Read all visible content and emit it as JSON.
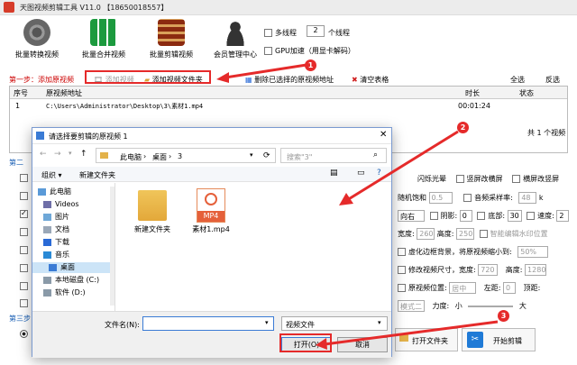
{
  "app": {
    "title": "天图视频剪辑工具 V11.0 【18650018557】"
  },
  "toolbar": {
    "buttons": [
      {
        "label": "批量转换视频",
        "icon": "film-reel-icon"
      },
      {
        "label": "批量合并视频",
        "icon": "merge-grid-icon"
      },
      {
        "label": "批量剪辑视频",
        "icon": "film-strip-icon"
      },
      {
        "label": "会员管理中心",
        "icon": "user-icon"
      }
    ],
    "multithread_label": "多线程",
    "thread_count": "2",
    "thread_unit": "个线程",
    "gpu_label": "GPU加速（用显卡解码）"
  },
  "step1": {
    "label": "第一步：添加原视频",
    "add_video": "添加视频",
    "add_folder": "添加视频文件夹",
    "delete_selected": "删除已选择的原视频地址",
    "clear_table": "清空表格",
    "select_all": "全选",
    "invert": "反选"
  },
  "table": {
    "headers": [
      "序号",
      "原视频地址",
      "时长",
      "状态"
    ],
    "rows": [
      {
        "index": "1",
        "path": "C:\\Users\\Administrator\\Desktop\\3\\素材1.mp4",
        "duration": "00:01:24",
        "status": ""
      }
    ],
    "total": "共 1 个视频"
  },
  "step2": {
    "label_fragment": "第二"
  },
  "step3": {
    "label_fragment": "第三步"
  },
  "right_panel": {
    "r1": [
      "闪烁光晕",
      "竖屏改横屏",
      "横屏改竖屏"
    ],
    "r2_labels": [
      "随机饱和",
      "0.5",
      "音频采样率:",
      "48",
      "k"
    ],
    "r3": [
      "向右",
      "阴影:",
      "0",
      "底部:",
      "30",
      "速度:",
      "2"
    ],
    "r4": [
      "宽度:",
      "260",
      "高度:",
      "250",
      "智能编辑水印位置"
    ],
    "r5": [
      "虚化边框背景，将原视频缩小到:",
      "50%"
    ],
    "r6": [
      "修改视频尺寸，宽度:",
      "720",
      "高度:",
      "1280"
    ],
    "r7": [
      "原视频位置:",
      "居中",
      "左距:",
      "0",
      "顶距:"
    ],
    "r8": [
      "模式二",
      "力度:",
      "小",
      "大"
    ]
  },
  "bottom": {
    "open_folder": "打开文件夹",
    "start": "开始剪辑"
  },
  "dialog": {
    "title": "请选择要剪辑的原视频 1",
    "breadcrumb": [
      "此电脑",
      "桌面",
      "3"
    ],
    "search_placeholder": "搜索\"3\"",
    "organize": "组织 ▾",
    "new_folder": "新建文件夹",
    "tree": [
      {
        "label": "此电脑",
        "icon": "computer-icon"
      },
      {
        "label": "Videos",
        "icon": "video-folder-icon"
      },
      {
        "label": "图片",
        "icon": "pictures-icon"
      },
      {
        "label": "文档",
        "icon": "documents-icon"
      },
      {
        "label": "下载",
        "icon": "download-icon"
      },
      {
        "label": "音乐",
        "icon": "music-icon"
      },
      {
        "label": "桌面",
        "icon": "desktop-icon"
      },
      {
        "label": "本地磁盘 (C:)",
        "icon": "drive-icon"
      },
      {
        "label": "软件 (D:)",
        "icon": "drive-icon"
      }
    ],
    "files": [
      {
        "name": "新建文件夹",
        "type": "folder"
      },
      {
        "name": "素材1.mp4",
        "type": "mp4",
        "badge": "MP4"
      }
    ],
    "filename_label": "文件名(N):",
    "filename_value": "",
    "filetype": "视频文件",
    "open": "打开(O)",
    "cancel": "取消"
  },
  "annotations": [
    "1",
    "2",
    "3"
  ],
  "colors": {
    "accent_red": "#e52a2a",
    "selection": "#cce4f7",
    "link_blue": "#1a5fb4"
  }
}
